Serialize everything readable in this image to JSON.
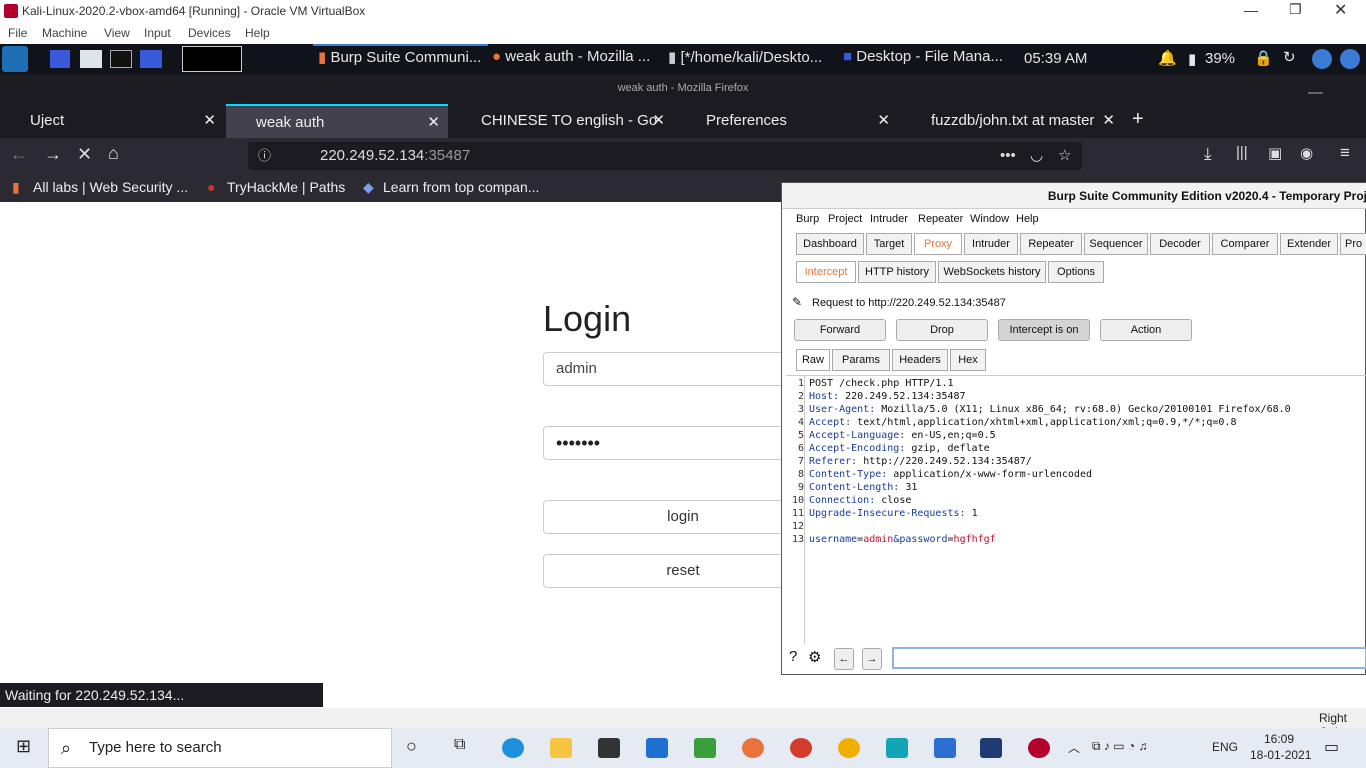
{
  "vbox": {
    "title": "Kali-Linux-2020.2-vbox-amd64 [Running] - Oracle VM VirtualBox",
    "menu": [
      "File",
      "Machine",
      "View",
      "Input",
      "Devices",
      "Help"
    ],
    "host_key": "Right Ctrl"
  },
  "kali_panel": {
    "tasks": [
      "Burp Suite Communi...",
      "weak auth - Mozilla ...",
      "[*/home/kali/Deskto...",
      "Desktop - File Mana..."
    ],
    "time": "05:39 AM",
    "battery": "39%"
  },
  "firefox": {
    "window_title": "weak auth - Mozilla Firefox",
    "tabs": [
      {
        "label": "Uject"
      },
      {
        "label": "weak auth"
      },
      {
        "label": "CHINESE TO english - Go"
      },
      {
        "label": "Preferences"
      },
      {
        "label": "fuzzdb/john.txt at master"
      }
    ],
    "url_host": "220.249.52.134",
    "url_port": ":35487",
    "bookmarks": [
      "All labs | Web Security ...",
      "TryHackMe | Paths",
      "Learn from top compan..."
    ],
    "status": "Waiting for 220.249.52.134..."
  },
  "login_page": {
    "title": "Login",
    "username": "admin",
    "password": "•••••••",
    "login_label": "login",
    "reset_label": "reset"
  },
  "burp": {
    "title": "Burp Suite Community Edition v2020.4 - Temporary Proj",
    "menu": [
      "Burp",
      "Project",
      "Intruder",
      "Repeater",
      "Window",
      "Help"
    ],
    "main_tabs": [
      "Dashboard",
      "Target",
      "Proxy",
      "Intruder",
      "Repeater",
      "Sequencer",
      "Decoder",
      "Comparer",
      "Extender",
      "Pro"
    ],
    "sub_tabs": [
      "Intercept",
      "HTTP history",
      "WebSockets history",
      "Options"
    ],
    "request_to": "Request to http://220.249.52.134:35487",
    "buttons": [
      "Forward",
      "Drop",
      "Intercept is on",
      "Action"
    ],
    "view_tabs": [
      "Raw",
      "Params",
      "Headers",
      "Hex"
    ],
    "lines": [
      {
        "n": "1",
        "key": "",
        "val": "POST /check.php HTTP/1.1"
      },
      {
        "n": "2",
        "key": "Host:",
        "val": " 220.249.52.134:35487"
      },
      {
        "n": "3",
        "key": "User-Agent:",
        "val": " Mozilla/5.0 (X11; Linux x86_64; rv:68.0) Gecko/20100101 Firefox/68.0"
      },
      {
        "n": "4",
        "key": "Accept:",
        "val": " text/html,application/xhtml+xml,application/xml;q=0.9,*/*;q=0.8"
      },
      {
        "n": "5",
        "key": "Accept-Language:",
        "val": " en-US,en;q=0.5"
      },
      {
        "n": "6",
        "key": "Accept-Encoding:",
        "val": " gzip, deflate"
      },
      {
        "n": "7",
        "key": "Referer:",
        "val": " http://220.249.52.134:35487/"
      },
      {
        "n": "8",
        "key": "Content-Type:",
        "val": " application/x-www-form-urlencoded"
      },
      {
        "n": "9",
        "key": "Content-Length:",
        "val": " 31"
      },
      {
        "n": "10",
        "key": "Connection:",
        "val": " close"
      },
      {
        "n": "11",
        "key": "Upgrade-Insecure-Requests:",
        "val": " 1"
      },
      {
        "n": "12",
        "key": "",
        "val": ""
      }
    ],
    "body": {
      "n": "13",
      "k1": "username",
      "v1": "admin",
      "amp": "&",
      "k2": "password",
      "v2": "hgfhfgf"
    }
  },
  "taskbar": {
    "search_placeholder": "Type here to search",
    "lang": "ENG",
    "time": "16:09",
    "date": "18-01-2021"
  },
  "colors": {
    "accent_orange": "#e8743b",
    "burp_key": "#1b3d9c",
    "burp_value": "#c8102e"
  }
}
